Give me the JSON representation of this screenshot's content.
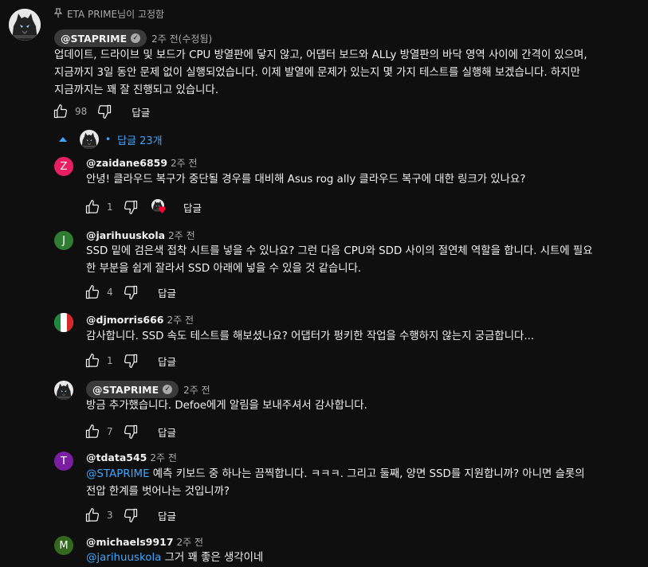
{
  "pinned_by": "ETA PRIME님이 고정함",
  "main_comment": {
    "author": "@STAPRIME",
    "time": "2주 전(수정됨)",
    "lines": [
      "업데이트, 드라이브 및 보드가 CPU 방열판에 닿지 않고, 어댑터 보드와 ALLy 방열판의 바닥 영역 사이에 간격이 있으며,",
      "지금까지 3일 동안 문제 없이 실행되었습니다. 이제 발열에 문제가 있는지 몇 가지 테스트를 실행해 보겠습니다. 하지만",
      "지금까지는 꽤 잘 진행되고 있습니다."
    ],
    "likes": "98",
    "reply_label": "답글"
  },
  "replies_toggle": {
    "label": "답글 23개"
  },
  "replies": [
    {
      "avatar_letter": "Z",
      "author": "@zaidane6859",
      "time": "2주 전",
      "lines": [
        "안녕! 클라우드 복구가 중단될 경우를 대비해 Asus rog ally 클라우드 복구에 대한 링크가 있나요?"
      ],
      "likes": "1",
      "reply_label": "답글"
    },
    {
      "avatar_letter": "J",
      "author": "@jarihuuskola",
      "time": "2주 전",
      "lines": [
        "SSD 밑에 검은색 접착 시트를 넣을 수 있나요? 그런 다음 CPU와 SDD 사이의 절연체 역할을 합니다. 시트에 필요",
        "한 부분을 쉽게 잘라서 SSD 아래에 넣을 수 있을 것 같습니다."
      ],
      "likes": "4",
      "reply_label": "답글"
    },
    {
      "author": "@djmorris666",
      "time": "2주 전",
      "lines": [
        "감사합니다. SSD 속도 테스트를 해보셨나요? 어댑터가 펑키한 작업을 수행하지 않는지 궁금합니다..."
      ],
      "likes": "1",
      "reply_label": "답글"
    },
    {
      "author": "@STAPRIME",
      "time": "2주 전",
      "lines": [
        "방금 추가했습니다. Defoe에게 알림을 보내주셔서 감사합니다."
      ],
      "likes": "7",
      "reply_label": "답글"
    },
    {
      "avatar_letter": "T",
      "author": "@tdata545",
      "time": "2주 전",
      "mention": "@STAPRIME",
      "line1_rest": " 예측 키보드 중 하나는 끔찍합니다. ㅋㅋㅋ. 그리고 둘째, 양면 SSD를 지원합니까? 아니면 슬롯의",
      "line2": "전압 한계를 벗어나는 것입니까?",
      "likes": "3",
      "reply_label": "답글"
    },
    {
      "avatar_letter": "M",
      "author": "@michaels9917",
      "time": "2주 전",
      "mention": "@jarihuuskola",
      "line1_rest": " 그거 꽤 좋은 생각이네"
    }
  ],
  "colors": {
    "z_avatar": "#e91e63",
    "j_avatar": "#2e7d32",
    "t_avatar": "#7b1fa2",
    "m_avatar": "#33691e",
    "link": "#3ea6ff",
    "heart": "#ff0033"
  }
}
